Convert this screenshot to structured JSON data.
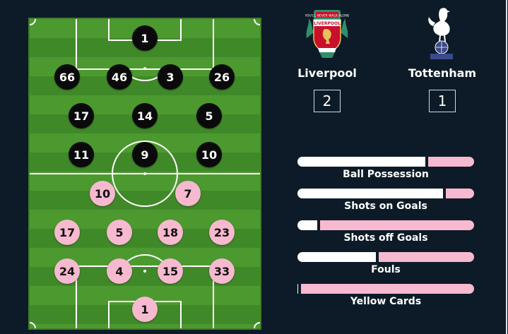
{
  "match": {
    "home": {
      "name": "Liverpool",
      "score": "2",
      "crest_icon": "liverpool-crest-icon",
      "color": "#0a0a0a"
    },
    "away": {
      "name": "Tottenham",
      "score": "1",
      "crest_icon": "tottenham-crest-icon",
      "color": "#f7b9cf"
    }
  },
  "lineup": {
    "home": [
      "1",
      "66",
      "46",
      "3",
      "26",
      "17",
      "14",
      "5",
      "11",
      "9",
      "10"
    ],
    "away": [
      "10",
      "7",
      "17",
      "5",
      "18",
      "23",
      "24",
      "4",
      "15",
      "33",
      "1"
    ]
  },
  "stats": [
    {
      "label": "Ball Possession",
      "home_share": 0.73
    },
    {
      "label": "Shots on Goals",
      "home_share": 0.83
    },
    {
      "label": "Shots off Goals",
      "home_share": 0.12
    },
    {
      "label": "Fouls",
      "home_share": 0.45
    },
    {
      "label": "Yellow Cards",
      "home_share": 0.01
    }
  ],
  "colors": {
    "background": "#0c1b27",
    "home_bar": "#ffffff",
    "away_bar": "#f7b9cf",
    "pitch": "#4c9a2f"
  }
}
